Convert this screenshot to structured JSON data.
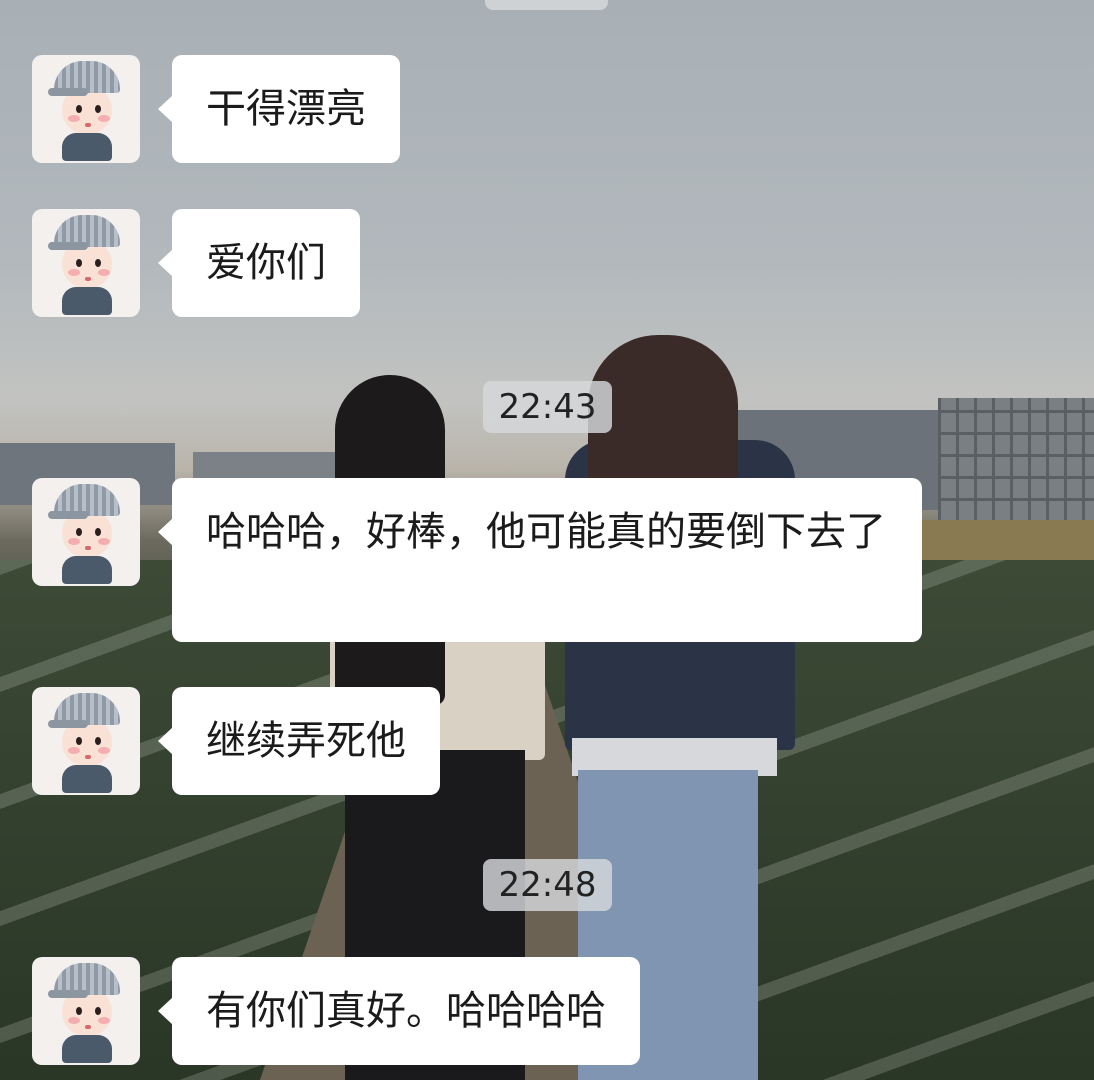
{
  "chat": {
    "messages": [
      {
        "id": "m1",
        "text": "干得漂亮"
      },
      {
        "id": "m2",
        "text": "爱你们"
      },
      {
        "id": "m3",
        "text": "哈哈哈，好棒，他可能真的要倒下去了"
      },
      {
        "id": "m4",
        "text": "继续弄死他"
      },
      {
        "id": "m5",
        "text": "有你们真好。哈哈哈哈"
      }
    ],
    "timestamps": {
      "t1": "22:43",
      "t2": "22:48"
    }
  },
  "colors": {
    "bubble": "#ffffff",
    "time_pill": "#d6d8da",
    "text": "#1b1b1b"
  },
  "icons": {
    "avatar": "cartoon-boy-avatar-icon"
  }
}
